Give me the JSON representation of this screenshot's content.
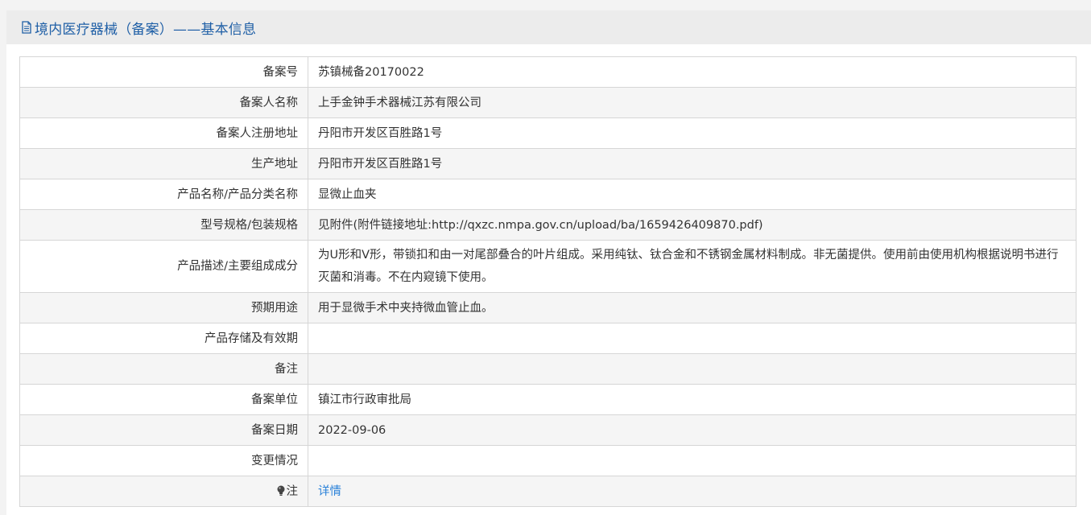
{
  "header": {
    "title": "境内医疗器械（备案）——基本信息"
  },
  "rows": [
    {
      "label": "备案号",
      "value": "苏镇械备20170022"
    },
    {
      "label": "备案人名称",
      "value": "上手金钟手术器械江苏有限公司"
    },
    {
      "label": "备案人注册地址",
      "value": "丹阳市开发区百胜路1号"
    },
    {
      "label": "生产地址",
      "value": "丹阳市开发区百胜路1号"
    },
    {
      "label": "产品名称/产品分类名称",
      "value": "显微止血夹"
    },
    {
      "label": "型号规格/包装规格",
      "value": "见附件(附件链接地址:http://qxzc.nmpa.gov.cn/upload/ba/1659426409870.pdf)"
    },
    {
      "label": "产品描述/主要组成成分",
      "value": "为U形和V形，带锁扣和由一对尾部叠合的叶片组成。采用纯钛、钛合金和不锈钢金属材料制成。非无菌提供。使用前由使用机构根据说明书进行灭菌和消毒。不在内窥镜下使用。"
    },
    {
      "label": "预期用途",
      "value": "用于显微手术中夹持微血管止血。"
    },
    {
      "label": "产品存储及有效期",
      "value": ""
    },
    {
      "label": "备注",
      "value": ""
    },
    {
      "label": "备案单位",
      "value": "镇江市行政审批局"
    },
    {
      "label": "备案日期",
      "value": "2022-09-06"
    },
    {
      "label": "变更情况",
      "value": ""
    },
    {
      "label": "注",
      "value": "详情"
    }
  ],
  "colors": {
    "title": "#1f5fa6",
    "link": "#2b82d9",
    "header_bg": "#ececec",
    "row_alt_bg": "#f5f5f5",
    "border": "#d6d6d6"
  }
}
